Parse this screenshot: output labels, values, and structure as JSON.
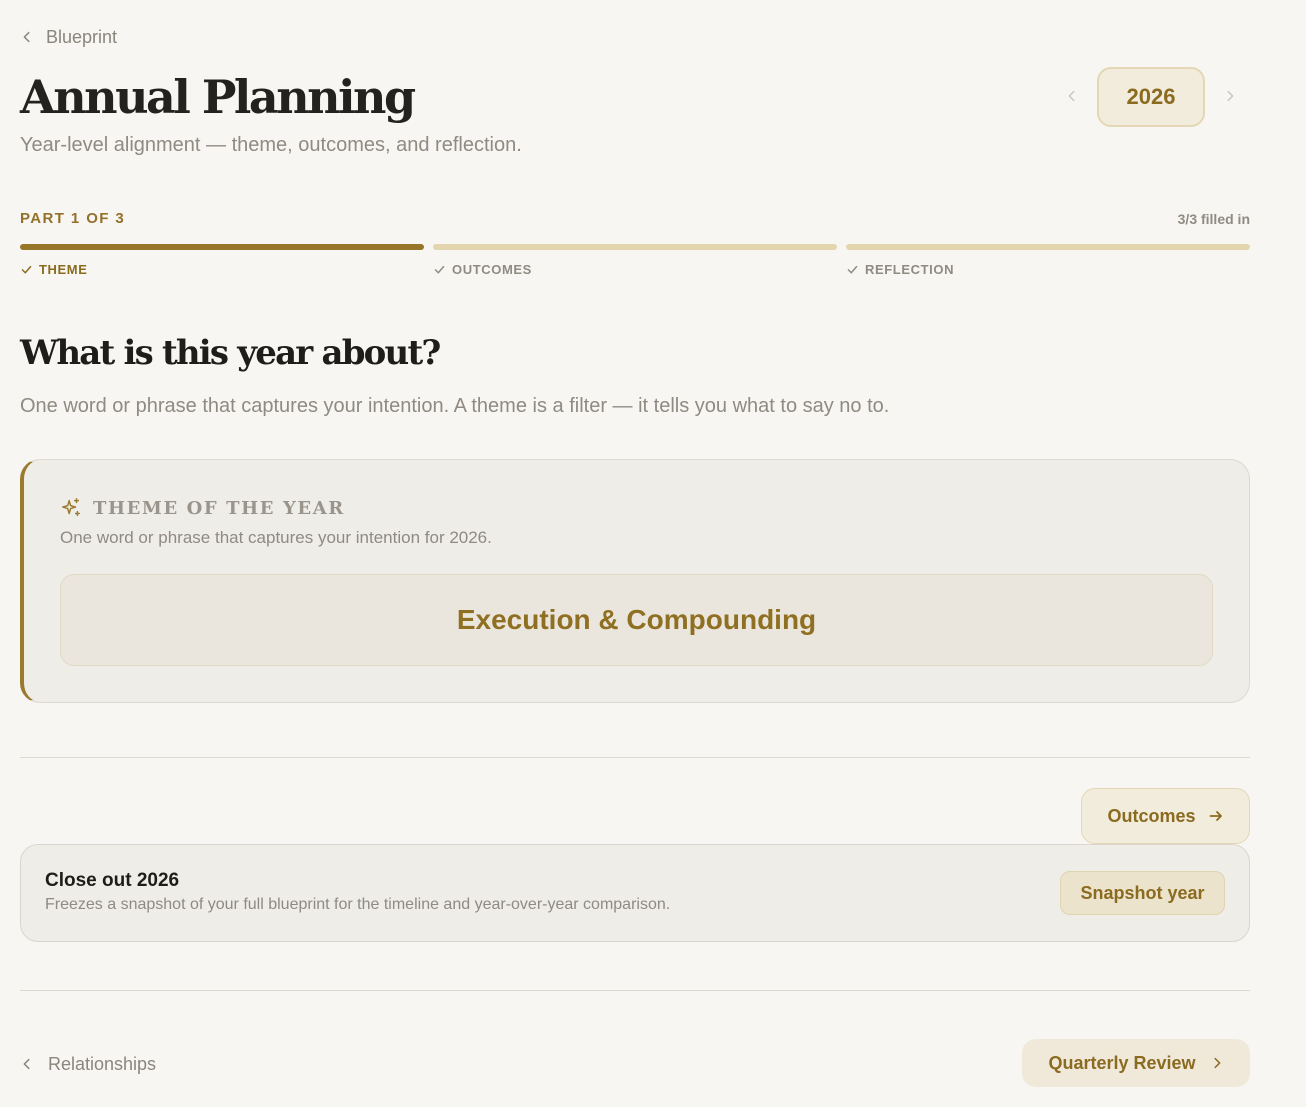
{
  "breadcrumb": {
    "back_label": "Blueprint",
    "icon": "chevron-left-icon"
  },
  "header": {
    "title": "Annual Planning",
    "subtitle": "Year-level alignment — theme, outcomes, and reflection."
  },
  "year_switcher": {
    "year": "2026",
    "prev_icon": "chevron-left-icon",
    "next_icon": "chevron-right-icon"
  },
  "progress": {
    "part_label": "PART 1 OF 3",
    "filled_label": "3/3 filled in",
    "current_step": 1,
    "steps": [
      {
        "label": "THEME",
        "complete": true
      },
      {
        "label": "OUTCOMES",
        "complete": true
      },
      {
        "label": "REFLECTION",
        "complete": true
      }
    ]
  },
  "section": {
    "heading": "What is this year about?",
    "description": "One word or phrase that captures your intention. A theme is a filter — it tells you what to say no to."
  },
  "theme_card": {
    "icon": "sparkles-icon",
    "label": "THEME OF THE YEAR",
    "description": "One word or phrase that captures your intention for 2026.",
    "value": "Execution & Compounding"
  },
  "next_section_button": {
    "label": "Outcomes",
    "icon": "arrow-right-icon"
  },
  "closeout": {
    "title": "Close out 2026",
    "description": "Freezes a snapshot of your full blueprint for the timeline and year-over-year comparison.",
    "button_label": "Snapshot year"
  },
  "footer_nav": {
    "prev_label": "Relationships",
    "next_label": "Quarterly Review"
  },
  "colors": {
    "accent": "#8a6b1f",
    "background": "#f7f6f3",
    "card": "#efede8",
    "progress_active": "#977629",
    "progress_inactive": "#e3d5ad"
  }
}
